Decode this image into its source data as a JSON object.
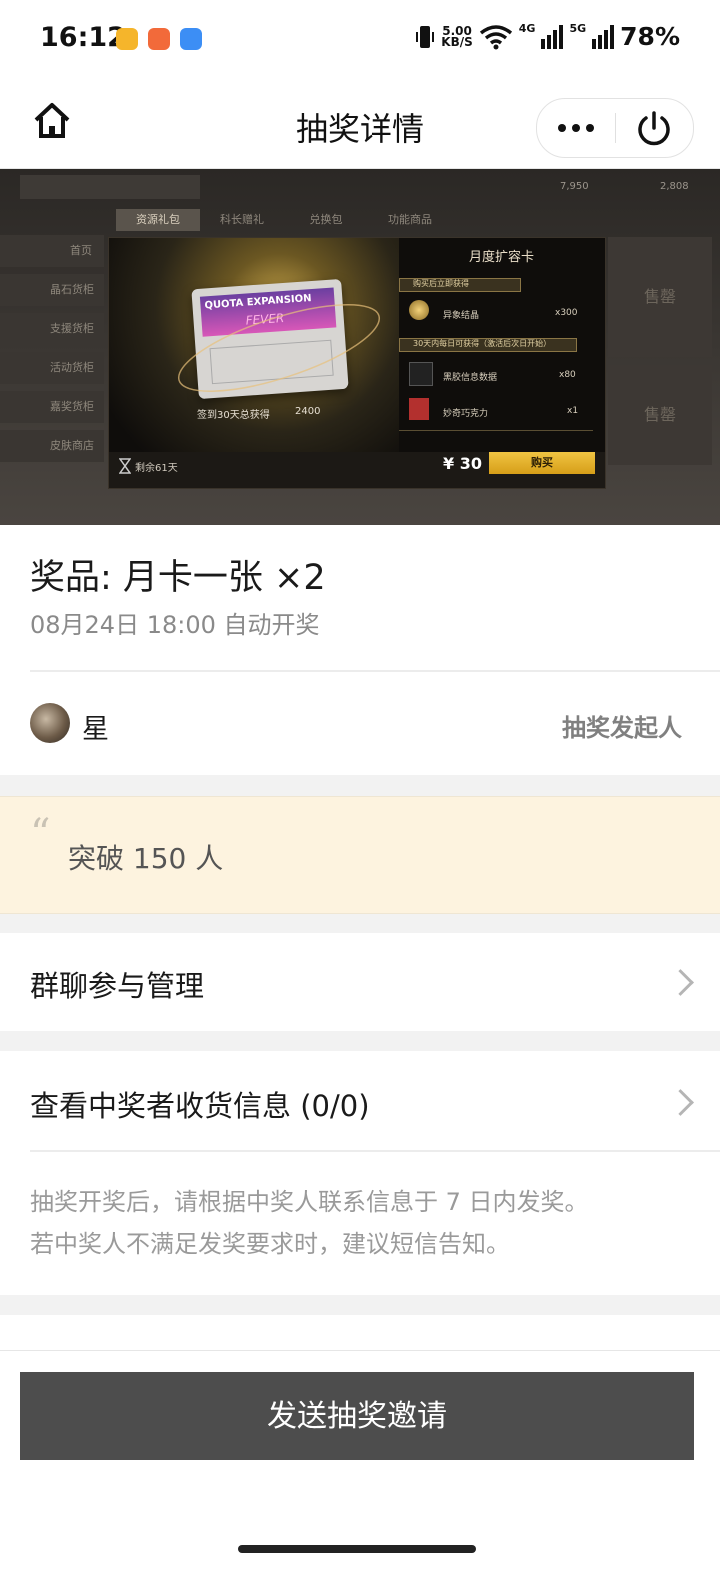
{
  "status_bar": {
    "time": "16:12",
    "network_speed": "5.00",
    "speed_unit": "KB/S",
    "sig1": "4G",
    "sig2": "5G",
    "battery": "78%",
    "app_icons": [
      "yellow-app-icon",
      "orange-app-icon",
      "blue-app-icon"
    ],
    "colors": {
      "app1": "#f5b52b",
      "app2": "#f26a3a",
      "app3": "#3c8ef5"
    }
  },
  "nav": {
    "title": "抽奖详情",
    "home_icon": "home-icon",
    "more_icon": "more-dots-icon",
    "power_icon": "power-icon"
  },
  "banner": {
    "tabs": [
      "资源礼包",
      "科长赠礼",
      "兑换包",
      "功能商品"
    ],
    "side_menu": [
      "首页",
      "晶石货柜",
      "支援货柜",
      "活动货柜",
      "嘉奖货柜",
      "皮肤商店"
    ],
    "top_counts": [
      "7,950",
      "2,808"
    ],
    "card_title": "月度扩容卡",
    "cart_name": "QUOTA EXPANSION",
    "cart_sub": "FEVER",
    "sign_text": "签到30天总获得",
    "sign_amount": "2400",
    "section1": "购买后立即获得",
    "item1_name": "异象结晶",
    "item1_qty": "x300",
    "section2": "30天内每日可获得（激活后次日开始）",
    "item2_name": "黑胶信息数据",
    "item2_qty": "x80",
    "item3_name": "妙奇巧克力",
    "item3_qty": "x1",
    "remaining": "剩余61天",
    "price": "¥ 30",
    "buy_label": "购买",
    "sold_out": "售罄"
  },
  "prize": {
    "title": "奖品: 月卡一张 ×2",
    "draw_time": "08月24日 18:00 自动开奖",
    "host_name": "星",
    "host_role": "抽奖发起人"
  },
  "quote": {
    "mark": "“",
    "text": "突破 150 人"
  },
  "rows": {
    "group_manage": "群聊参与管理",
    "winner_info": "查看中奖者收货信息 (0/0)",
    "note_line1": "抽奖开奖后，请根据中奖人联系信息于 7 日内发奖。",
    "note_line2": "若中奖人不满足发奖要求时，建议短信告知。"
  },
  "actions": {
    "send_invite": "发送抽奖邀请"
  }
}
